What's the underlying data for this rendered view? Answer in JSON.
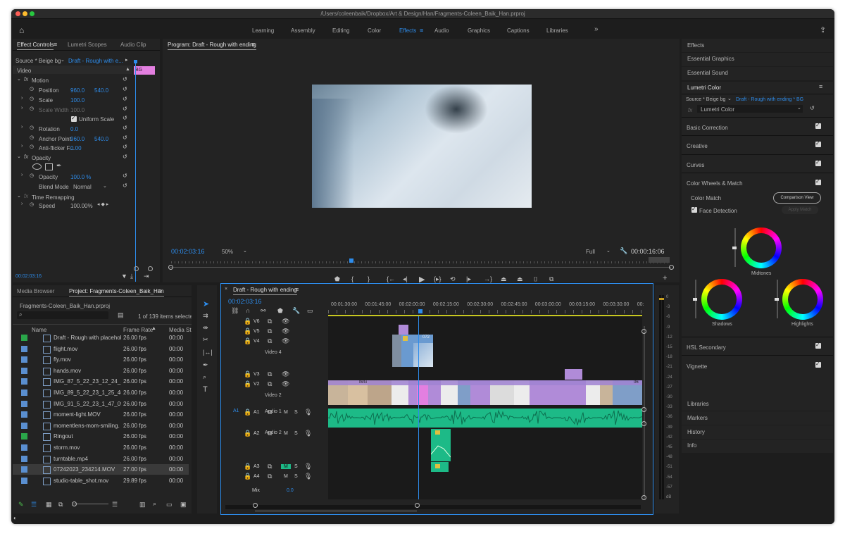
{
  "window": {
    "title": "/Users/coleenbaik/Dropbox/Art & Design/Han/Fragments-Coleen_Baik_Han.prproj"
  },
  "workspaces": {
    "tabs": [
      "Learning",
      "Assembly",
      "Editing",
      "Color",
      "Effects",
      "Audio",
      "Graphics",
      "Captions",
      "Libraries"
    ],
    "active": "Effects",
    "more": "»"
  },
  "effect_controls": {
    "tabs": [
      "Effect Controls",
      "Lumetri Scopes",
      "Audio Clip"
    ],
    "source": "Source * Beige bg",
    "sequence_link": "Draft - Rough with e...",
    "clip_label": "BG",
    "section": "Video",
    "motion": "Motion",
    "position_label": "Position",
    "position_x": "960.0",
    "position_y": "540.0",
    "scale_label": "Scale",
    "scale_value": "100.0",
    "scale_width_label": "Scale Width",
    "scale_width_value": "100.0",
    "uniform_scale": "Uniform Scale",
    "rotation_label": "Rotation",
    "rotation_value": "0.0",
    "anchor_label": "Anchor Point",
    "anchor_x": "960.0",
    "anchor_y": "540.0",
    "antiflicker_label": "Anti-flicker F...",
    "antiflicker_value": "0.00",
    "opacity_section": "Opacity",
    "opacity_label": "Opacity",
    "opacity_value": "100.0 %",
    "blend_label": "Blend Mode",
    "blend_value": "Normal",
    "time_remap": "Time Remapping",
    "speed_label": "Speed",
    "speed_value": "100.00%",
    "timecode": "00:02:03:16"
  },
  "program": {
    "title": "Program: Draft - Rough with ending",
    "timecode": "00:02:03:16",
    "zoom": "50%",
    "quality": "Full",
    "duration": "00:00:16:06"
  },
  "project": {
    "tabs": [
      "Media Browser",
      "Project: Fragments-Coleen_Baik_Han"
    ],
    "file": "Fragments-Coleen_Baik_Han.prproj",
    "count": "1 of 139 items selected",
    "columns": [
      "Name",
      "Frame Rate",
      "Media St"
    ],
    "rows": [
      {
        "name": "Draft - Rough with placehold",
        "fps": "26.00 fps",
        "start": "00:00",
        "color": "#2aa64a"
      },
      {
        "name": "flight.mov",
        "fps": "26.00 fps",
        "start": "00:00",
        "color": "#5a8fd0"
      },
      {
        "name": "fly.mov",
        "fps": "26.00 fps",
        "start": "00:00",
        "color": "#5a8fd0"
      },
      {
        "name": "hands.mov",
        "fps": "26.00 fps",
        "start": "00:00",
        "color": "#5a8fd0"
      },
      {
        "name": "IMG_87_5_22_23_12_24_1",
        "fps": "26.00 fps",
        "start": "00:00",
        "color": "#5a8fd0"
      },
      {
        "name": "IMG_89_5_22_23_1_25_46",
        "fps": "26.00 fps",
        "start": "00:00",
        "color": "#5a8fd0"
      },
      {
        "name": "IMG_91_5_22_23_1_47_09",
        "fps": "26.00 fps",
        "start": "00:00",
        "color": "#5a8fd0"
      },
      {
        "name": "moment-light.MOV",
        "fps": "26.00 fps",
        "start": "00:00",
        "color": "#5a8fd0"
      },
      {
        "name": "momentlens-mom-smiling.",
        "fps": "26.00 fps",
        "start": "00:00",
        "color": "#5a8fd0"
      },
      {
        "name": "Ringout",
        "fps": "26.00 fps",
        "start": "00:00",
        "color": "#2aa64a"
      },
      {
        "name": "storm.mov",
        "fps": "26.00 fps",
        "start": "00:00",
        "color": "#5a8fd0"
      },
      {
        "name": "turntable.mp4",
        "fps": "26.00 fps",
        "start": "00:00",
        "color": "#5a8fd0"
      },
      {
        "name": "07242023_234214.MOV",
        "fps": "27.00 fps",
        "start": "00:00",
        "color": "#5a8fd0"
      },
      {
        "name": "studio-table_shot.mov",
        "fps": "29.89 fps",
        "start": "00:00",
        "color": "#5a8fd0"
      }
    ],
    "selected_row": 12
  },
  "timeline": {
    "title": "Draft - Rough with ending",
    "timecode": "00:02:03:16",
    "ruler": [
      "00:01:30:00",
      "00:01:45:00",
      "00:02:00:00",
      "00:02:15:00",
      "00:02:30:00",
      "00:02:45:00",
      "00:03:00:00",
      "00:03:15:00",
      "00:03:30:00",
      "00:"
    ],
    "tracks": {
      "v6": "V6",
      "v5": "V5",
      "v4": "V4",
      "v4_name": "Video 4",
      "v3": "V3",
      "v2": "V2",
      "v2_name": "Video 2",
      "a1": "A1",
      "a1_name": "Audio 1",
      "a2": "A2",
      "a2_name": "Audio 2",
      "a3": "A3",
      "a4": "A4",
      "mix": "Mix",
      "mix_value": "0.0",
      "src_a1": "A1"
    },
    "clip_labels": {
      "c072": "072",
      "img": "IMG",
      "c06": "06"
    },
    "m": "M",
    "s": "S"
  },
  "meter": {
    "ticks": [
      "0",
      "-3",
      "-6",
      "-9",
      "-12",
      "-15",
      "-18",
      "-21",
      "-24",
      "-27",
      "-30",
      "-33",
      "-36",
      "-39",
      "-42",
      "-45",
      "-48",
      "-51",
      "-54",
      "-57",
      "dB"
    ]
  },
  "right_panel": {
    "items_top": [
      "Effects",
      "Essential Graphics",
      "Essential Sound"
    ],
    "lumetri_title": "Lumetri Color",
    "source": "Source * Beige bg",
    "sequence_link": "Draft - Rough with ending * BG",
    "fx_value": "Lumetri Color",
    "sections": [
      "Basic Correction",
      "Creative",
      "Curves",
      "Color Wheels & Match"
    ],
    "color_match": "Color Match",
    "comparison": "Comparison View",
    "face_detection": "Face Detection",
    "apply_match": "Apply Match",
    "midtones": "Midtones",
    "shadows": "Shadows",
    "highlights": "Highlights",
    "hsl": "HSL Secondary",
    "vignette": "Vignette",
    "items_bottom": [
      "Libraries",
      "Markers",
      "History",
      "Info"
    ]
  }
}
